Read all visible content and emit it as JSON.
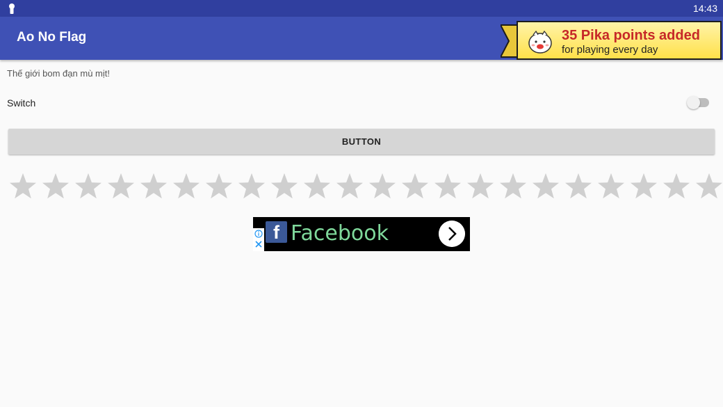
{
  "status_bar": {
    "time": "14:43"
  },
  "app_bar": {
    "title": "Ao No Flag"
  },
  "notification": {
    "headline": "35 Pika points added",
    "subline": "for playing every day"
  },
  "content": {
    "text": "Thế giới bom đạn mù mịt!",
    "switch_label": "Switch",
    "switch_on": false,
    "button_label": "BUTTON",
    "rating": {
      "total_stars": 22,
      "filled": 0
    }
  },
  "ad": {
    "brand": "Facebook"
  },
  "colors": {
    "status_bar": "#303f9f",
    "app_bar": "#3f51b5",
    "star": "#cfcfcf",
    "ad_text": "#7fd89b",
    "headline": "#c62828"
  }
}
